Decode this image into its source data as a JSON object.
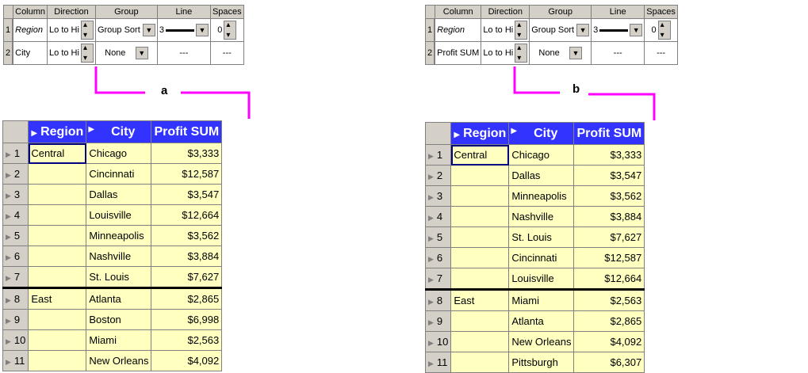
{
  "panels": [
    {
      "sort_grid": {
        "headers": [
          "Column",
          "Direction",
          "Group",
          "Line",
          "Spaces"
        ],
        "rows": [
          {
            "num": "1",
            "column": "Region",
            "direction": "Lo to Hi",
            "group": "Group Sort",
            "line": "3",
            "spaces": "0"
          },
          {
            "num": "2",
            "column": "City",
            "direction": "Lo to Hi",
            "group": "None",
            "line": "---",
            "spaces": "---"
          }
        ]
      },
      "label": "a",
      "data_grid": {
        "headers": [
          "Region",
          "City",
          "Profit SUM"
        ],
        "rows": [
          {
            "num": "1",
            "region": "Central",
            "city": "Chicago",
            "profit": "$3,333"
          },
          {
            "num": "2",
            "region": "",
            "city": "Cincinnati",
            "profit": "$12,587"
          },
          {
            "num": "3",
            "region": "",
            "city": "Dallas",
            "profit": "$3,547"
          },
          {
            "num": "4",
            "region": "",
            "city": "Louisville",
            "profit": "$12,664"
          },
          {
            "num": "5",
            "region": "",
            "city": "Minneapolis",
            "profit": "$3,562"
          },
          {
            "num": "6",
            "region": "",
            "city": "Nashville",
            "profit": "$3,884"
          },
          {
            "num": "7",
            "region": "",
            "city": "St. Louis",
            "profit": "$7,627"
          },
          {
            "num": "8",
            "region": "East",
            "city": "Atlanta",
            "profit": "$2,865"
          },
          {
            "num": "9",
            "region": "",
            "city": "Boston",
            "profit": "$6,998"
          },
          {
            "num": "10",
            "region": "",
            "city": "Miami",
            "profit": "$2,563"
          },
          {
            "num": "11",
            "region": "",
            "city": "New Orleans",
            "profit": "$4,092"
          }
        ]
      }
    },
    {
      "sort_grid": {
        "headers": [
          "Column",
          "Direction",
          "Group",
          "Line",
          "Spaces"
        ],
        "rows": [
          {
            "num": "1",
            "column": "Region",
            "direction": "Lo to Hi",
            "group": "Group Sort",
            "line": "3",
            "spaces": "0"
          },
          {
            "num": "2",
            "column": "Profit SUM",
            "direction": "Lo to Hi",
            "group": "None",
            "line": "---",
            "spaces": "---"
          }
        ]
      },
      "label": "b",
      "data_grid": {
        "headers": [
          "Region",
          "City",
          "Profit SUM"
        ],
        "rows": [
          {
            "num": "1",
            "region": "Central",
            "city": "Chicago",
            "profit": "$3,333"
          },
          {
            "num": "2",
            "region": "",
            "city": "Dallas",
            "profit": "$3,547"
          },
          {
            "num": "3",
            "region": "",
            "city": "Minneapolis",
            "profit": "$3,562"
          },
          {
            "num": "4",
            "region": "",
            "city": "Nashville",
            "profit": "$3,884"
          },
          {
            "num": "5",
            "region": "",
            "city": "St. Louis",
            "profit": "$7,627"
          },
          {
            "num": "6",
            "region": "",
            "city": "Cincinnati",
            "profit": "$12,587"
          },
          {
            "num": "7",
            "region": "",
            "city": "Louisville",
            "profit": "$12,664"
          },
          {
            "num": "8",
            "region": "East",
            "city": "Miami",
            "profit": "$2,563"
          },
          {
            "num": "9",
            "region": "",
            "city": "Atlanta",
            "profit": "$2,865"
          },
          {
            "num": "10",
            "region": "",
            "city": "New Orleans",
            "profit": "$4,092"
          },
          {
            "num": "11",
            "region": "",
            "city": "Pittsburgh",
            "profit": "$6,307"
          }
        ]
      }
    }
  ],
  "colors": {
    "header_bg": "#3333ff",
    "cell_bg": "#ffffc0",
    "chrome_bg": "#d4d0c8",
    "connector": "#ff00ff"
  }
}
